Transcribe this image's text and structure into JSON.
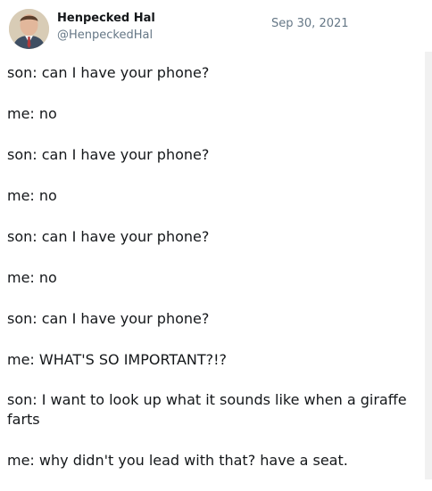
{
  "tweet": {
    "author": {
      "display_name": "Henpecked Hal",
      "handle": "@HenpeckedHal",
      "avatar": "avatar-photo"
    },
    "date": "Sep 30, 2021",
    "lines": [
      "son: can I have your phone?",
      "me: no",
      "son: can I have your phone?",
      "me: no",
      "son: can I have your phone?",
      "me: no",
      "son: can I have your phone?",
      "me: WHAT'S SO IMPORTANT?!?",
      "son: I want to look up what it sounds like when a giraffe farts",
      "me: why didn't you lead with that? have a seat."
    ]
  },
  "colors": {
    "text": "#14171a",
    "secondary": "#657786",
    "background": "#ffffff"
  }
}
